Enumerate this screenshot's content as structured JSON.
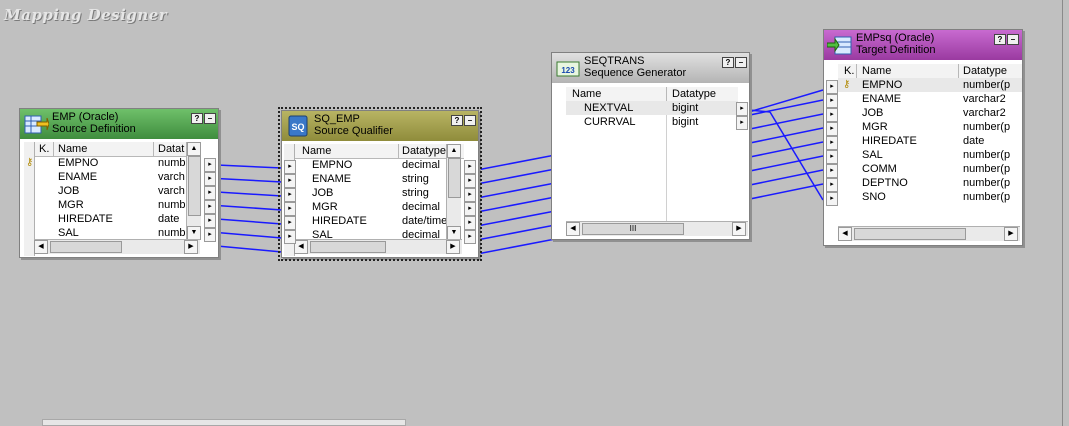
{
  "app": {
    "canvas_title": "Mapping Designer"
  },
  "colors": {
    "source_header": "#5aa858",
    "qualifier_header": "#a09d48",
    "sequence_header": "#c8c8c8",
    "target_header": "#b050b8",
    "link_wire": "#1a1aff"
  },
  "header_buttons": {
    "help": "?",
    "minimize": "–"
  },
  "arrow_glyph": "▸",
  "source": {
    "name": "EMP (Oracle)",
    "type": "Source Definition",
    "icon": "source-table-icon",
    "columns": {
      "key": "K.",
      "name": "Name",
      "datatype": "Datat"
    },
    "rows": [
      {
        "key": true,
        "name": "EMPNO",
        "datatype": "numbe"
      },
      {
        "key": false,
        "name": "ENAME",
        "datatype": "varch"
      },
      {
        "key": false,
        "name": "JOB",
        "datatype": "varch"
      },
      {
        "key": false,
        "name": "MGR",
        "datatype": "numbe"
      },
      {
        "key": false,
        "name": "HIREDATE",
        "datatype": "date"
      },
      {
        "key": false,
        "name": "SAL",
        "datatype": "numb"
      }
    ]
  },
  "qualifier": {
    "name": "SQ_EMP",
    "type": "Source Qualifier",
    "icon": "source-qualifier-icon",
    "columns": {
      "name": "Name",
      "datatype": "Datatype"
    },
    "rows": [
      {
        "name": "EMPNO",
        "datatype": "decimal"
      },
      {
        "name": "ENAME",
        "datatype": "string"
      },
      {
        "name": "JOB",
        "datatype": "string"
      },
      {
        "name": "MGR",
        "datatype": "decimal"
      },
      {
        "name": "HIREDATE",
        "datatype": "date/time"
      },
      {
        "name": "SAL",
        "datatype": "decimal"
      }
    ]
  },
  "sequence": {
    "name": "SEQTRANS",
    "type": "Sequence Generator",
    "icon": "sequence-generator-icon",
    "columns": {
      "name": "Name",
      "datatype": "Datatype"
    },
    "rows": [
      {
        "name": "NEXTVAL",
        "datatype": "bigint"
      },
      {
        "name": "CURRVAL",
        "datatype": "bigint"
      }
    ],
    "scroll_thumb": "III"
  },
  "target": {
    "name": "EMPsq (Oracle)",
    "type": "Target Definition",
    "icon": "target-table-icon",
    "columns": {
      "key": "K.",
      "name": "Name",
      "datatype": "Datatype"
    },
    "rows": [
      {
        "key": true,
        "name": "EMPNO",
        "datatype": "number(p"
      },
      {
        "key": false,
        "name": "ENAME",
        "datatype": "varchar2"
      },
      {
        "key": false,
        "name": "JOB",
        "datatype": "varchar2"
      },
      {
        "key": false,
        "name": "MGR",
        "datatype": "number(p"
      },
      {
        "key": false,
        "name": "HIREDATE",
        "datatype": "date"
      },
      {
        "key": false,
        "name": "SAL",
        "datatype": "number(p"
      },
      {
        "key": false,
        "name": "COMM",
        "datatype": "number(p"
      },
      {
        "key": false,
        "name": "DEPTNO",
        "datatype": "number(p"
      },
      {
        "key": false,
        "name": "SNO",
        "datatype": "number(p"
      }
    ]
  }
}
